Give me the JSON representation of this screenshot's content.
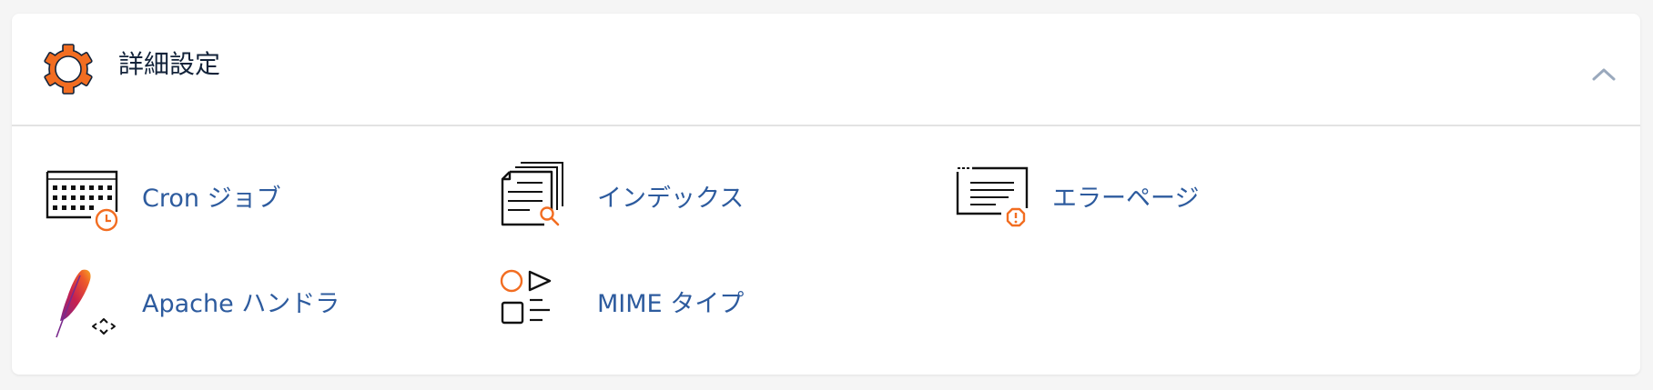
{
  "section": {
    "title": "詳細設定",
    "header_icon": "gear-icon",
    "collapse_icon": "chevron-up-icon",
    "accent_color": "#f26d21",
    "link_color": "#2d5b9e"
  },
  "tools": [
    {
      "label": "Cron ジョブ",
      "icon": "calendar-clock-icon"
    },
    {
      "label": "インデックス",
      "icon": "document-search-icon"
    },
    {
      "label": "エラーページ",
      "icon": "page-error-icon"
    },
    {
      "label": "Apache ハンドラ",
      "icon": "apache-feather-icon"
    },
    {
      "label": "MIME タイプ",
      "icon": "shapes-icon"
    }
  ]
}
